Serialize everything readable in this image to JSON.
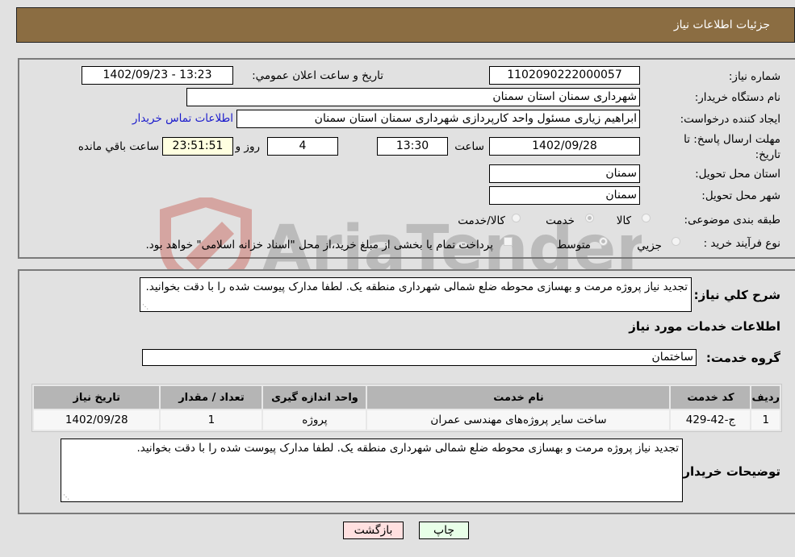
{
  "header": {
    "title": "جزئیات اطلاعات نیاز"
  },
  "form": {
    "need_number": {
      "label": "شماره نیاز:",
      "value": "1102090222000057"
    },
    "announce_datetime": {
      "label": "تاریخ و ساعت اعلان عمومي:",
      "value": "1402/09/23 - 13:23"
    },
    "buyer_org": {
      "label": "نام دستگاه خریدار:",
      "value": "شهرداری سمنان استان سمنان"
    },
    "requester": {
      "label": "ایجاد کننده درخواست:",
      "value": "ابراهیم زیاری مسئول واحد کارپردازی شهرداری سمنان استان سمنان"
    },
    "buyer_contact_link": "اطلاعات تماس خریدار",
    "deadline": {
      "label": "مهلت ارسال پاسخ: تا تاریخ:",
      "date": "1402/09/28",
      "time_label": "ساعت",
      "time": "13:30",
      "days": "4",
      "days_label": "روز و",
      "remaining": "23:51:51",
      "remaining_label": "ساعت باقي مانده"
    },
    "delivery_province": {
      "label": "استان محل تحویل:",
      "value": "سمنان"
    },
    "delivery_city": {
      "label": "شهر محل تحویل:",
      "value": "سمنان"
    },
    "category": {
      "label": "طبقه بندی موضوعی:",
      "options": [
        "کالا",
        "خدمت",
        "کالا/خدمت"
      ],
      "selected": "خدمت"
    },
    "purchase_type": {
      "label": "نوع فرآیند خرید :",
      "options": [
        "جزیي",
        "متوسط"
      ],
      "selected": "متوسط",
      "treasury_note": "پرداخت تمام یا بخشی از مبلغ خرید،از محل \"اسناد خزانه اسلامی\" خواهد بود."
    }
  },
  "description": {
    "label": "شرح کلي نیاز:",
    "value": "تجدید نیاز پروژه مرمت و بهسازی محوطه ضلع شمالی شهرداری منطقه یک. لطفا مدارک پیوست شده را با دقت بخوانید."
  },
  "services": {
    "section_title": "اطلاعات خدمات مورد نیاز",
    "group_label": "گروه خدمت:",
    "group_value": "ساختمان",
    "table": {
      "headers": [
        "ردیف",
        "کد خدمت",
        "نام خدمت",
        "واحد اندازه گیری",
        "تعداد / مقدار",
        "تاریخ نیاز"
      ],
      "rows": [
        [
          "1",
          "ج-42-429",
          "ساخت سایر پروژه‌های مهندسی عمران",
          "پروژه",
          "1",
          "1402/09/28"
        ]
      ]
    }
  },
  "buyer_notes": {
    "label": "توضیحات خریدار:",
    "value": "تجدید نیاز پروژه مرمت و بهسازی محوطه ضلع شمالی شهرداری منطقه یک. لطفا مدارک پیوست شده را با دقت بخوانید."
  },
  "buttons": {
    "print": "چاپ",
    "back": "بازگشت"
  },
  "colors": {
    "header_bg": "#8b6d42",
    "back_btn_bg": "#ffe0e0",
    "print_btn_bg": "#e8ffe8",
    "link": "#1a1acc"
  },
  "watermark": "AriaTender.neT"
}
